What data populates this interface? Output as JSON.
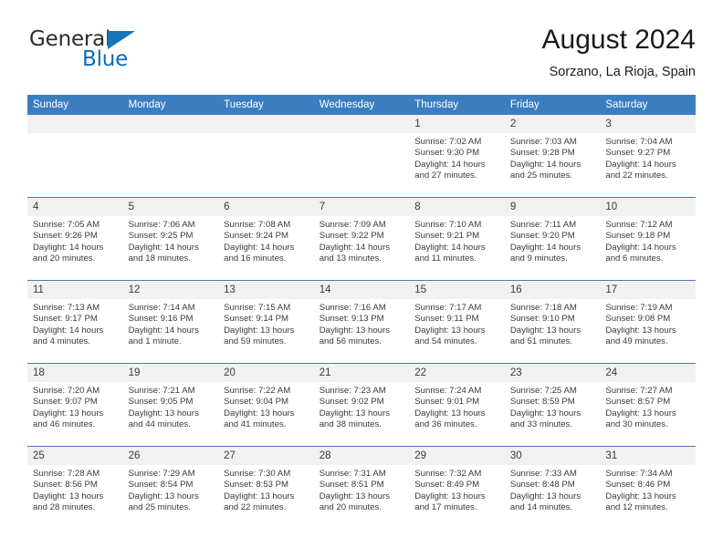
{
  "brand": {
    "name_part1": "General",
    "name_part2": "Blue",
    "flag_icon": "blue-triangle-flag-icon"
  },
  "header": {
    "title": "August 2024",
    "subtitle": "Sorzano, La Rioja, Spain"
  },
  "theme": {
    "header_blue": "#3b7ec0",
    "brand_blue": "#0a6cb5",
    "daynum_band": "#f1f1f1",
    "text": "#3a3a3a"
  },
  "columns": [
    "Sunday",
    "Monday",
    "Tuesday",
    "Wednesday",
    "Thursday",
    "Friday",
    "Saturday"
  ],
  "weeks": [
    [
      {
        "day": "",
        "empty": true
      },
      {
        "day": "",
        "empty": true
      },
      {
        "day": "",
        "empty": true
      },
      {
        "day": "",
        "empty": true
      },
      {
        "day": "1",
        "sunrise": "Sunrise: 7:02 AM",
        "sunset": "Sunset: 9:30 PM",
        "daylight": "Daylight: 14 hours and 27 minutes."
      },
      {
        "day": "2",
        "sunrise": "Sunrise: 7:03 AM",
        "sunset": "Sunset: 9:28 PM",
        "daylight": "Daylight: 14 hours and 25 minutes."
      },
      {
        "day": "3",
        "sunrise": "Sunrise: 7:04 AM",
        "sunset": "Sunset: 9:27 PM",
        "daylight": "Daylight: 14 hours and 22 minutes."
      }
    ],
    [
      {
        "day": "4",
        "sunrise": "Sunrise: 7:05 AM",
        "sunset": "Sunset: 9:26 PM",
        "daylight": "Daylight: 14 hours and 20 minutes."
      },
      {
        "day": "5",
        "sunrise": "Sunrise: 7:06 AM",
        "sunset": "Sunset: 9:25 PM",
        "daylight": "Daylight: 14 hours and 18 minutes."
      },
      {
        "day": "6",
        "sunrise": "Sunrise: 7:08 AM",
        "sunset": "Sunset: 9:24 PM",
        "daylight": "Daylight: 14 hours and 16 minutes."
      },
      {
        "day": "7",
        "sunrise": "Sunrise: 7:09 AM",
        "sunset": "Sunset: 9:22 PM",
        "daylight": "Daylight: 14 hours and 13 minutes."
      },
      {
        "day": "8",
        "sunrise": "Sunrise: 7:10 AM",
        "sunset": "Sunset: 9:21 PM",
        "daylight": "Daylight: 14 hours and 11 minutes."
      },
      {
        "day": "9",
        "sunrise": "Sunrise: 7:11 AM",
        "sunset": "Sunset: 9:20 PM",
        "daylight": "Daylight: 14 hours and 9 minutes."
      },
      {
        "day": "10",
        "sunrise": "Sunrise: 7:12 AM",
        "sunset": "Sunset: 9:18 PM",
        "daylight": "Daylight: 14 hours and 6 minutes."
      }
    ],
    [
      {
        "day": "11",
        "sunrise": "Sunrise: 7:13 AM",
        "sunset": "Sunset: 9:17 PM",
        "daylight": "Daylight: 14 hours and 4 minutes."
      },
      {
        "day": "12",
        "sunrise": "Sunrise: 7:14 AM",
        "sunset": "Sunset: 9:16 PM",
        "daylight": "Daylight: 14 hours and 1 minute."
      },
      {
        "day": "13",
        "sunrise": "Sunrise: 7:15 AM",
        "sunset": "Sunset: 9:14 PM",
        "daylight": "Daylight: 13 hours and 59 minutes."
      },
      {
        "day": "14",
        "sunrise": "Sunrise: 7:16 AM",
        "sunset": "Sunset: 9:13 PM",
        "daylight": "Daylight: 13 hours and 56 minutes."
      },
      {
        "day": "15",
        "sunrise": "Sunrise: 7:17 AM",
        "sunset": "Sunset: 9:11 PM",
        "daylight": "Daylight: 13 hours and 54 minutes."
      },
      {
        "day": "16",
        "sunrise": "Sunrise: 7:18 AM",
        "sunset": "Sunset: 9:10 PM",
        "daylight": "Daylight: 13 hours and 51 minutes."
      },
      {
        "day": "17",
        "sunrise": "Sunrise: 7:19 AM",
        "sunset": "Sunset: 9:08 PM",
        "daylight": "Daylight: 13 hours and 49 minutes."
      }
    ],
    [
      {
        "day": "18",
        "sunrise": "Sunrise: 7:20 AM",
        "sunset": "Sunset: 9:07 PM",
        "daylight": "Daylight: 13 hours and 46 minutes."
      },
      {
        "day": "19",
        "sunrise": "Sunrise: 7:21 AM",
        "sunset": "Sunset: 9:05 PM",
        "daylight": "Daylight: 13 hours and 44 minutes."
      },
      {
        "day": "20",
        "sunrise": "Sunrise: 7:22 AM",
        "sunset": "Sunset: 9:04 PM",
        "daylight": "Daylight: 13 hours and 41 minutes."
      },
      {
        "day": "21",
        "sunrise": "Sunrise: 7:23 AM",
        "sunset": "Sunset: 9:02 PM",
        "daylight": "Daylight: 13 hours and 38 minutes."
      },
      {
        "day": "22",
        "sunrise": "Sunrise: 7:24 AM",
        "sunset": "Sunset: 9:01 PM",
        "daylight": "Daylight: 13 hours and 36 minutes."
      },
      {
        "day": "23",
        "sunrise": "Sunrise: 7:25 AM",
        "sunset": "Sunset: 8:59 PM",
        "daylight": "Daylight: 13 hours and 33 minutes."
      },
      {
        "day": "24",
        "sunrise": "Sunrise: 7:27 AM",
        "sunset": "Sunset: 8:57 PM",
        "daylight": "Daylight: 13 hours and 30 minutes."
      }
    ],
    [
      {
        "day": "25",
        "sunrise": "Sunrise: 7:28 AM",
        "sunset": "Sunset: 8:56 PM",
        "daylight": "Daylight: 13 hours and 28 minutes."
      },
      {
        "day": "26",
        "sunrise": "Sunrise: 7:29 AM",
        "sunset": "Sunset: 8:54 PM",
        "daylight": "Daylight: 13 hours and 25 minutes."
      },
      {
        "day": "27",
        "sunrise": "Sunrise: 7:30 AM",
        "sunset": "Sunset: 8:53 PM",
        "daylight": "Daylight: 13 hours and 22 minutes."
      },
      {
        "day": "28",
        "sunrise": "Sunrise: 7:31 AM",
        "sunset": "Sunset: 8:51 PM",
        "daylight": "Daylight: 13 hours and 20 minutes."
      },
      {
        "day": "29",
        "sunrise": "Sunrise: 7:32 AM",
        "sunset": "Sunset: 8:49 PM",
        "daylight": "Daylight: 13 hours and 17 minutes."
      },
      {
        "day": "30",
        "sunrise": "Sunrise: 7:33 AM",
        "sunset": "Sunset: 8:48 PM",
        "daylight": "Daylight: 13 hours and 14 minutes."
      },
      {
        "day": "31",
        "sunrise": "Sunrise: 7:34 AM",
        "sunset": "Sunset: 8:46 PM",
        "daylight": "Daylight: 13 hours and 12 minutes."
      }
    ]
  ]
}
